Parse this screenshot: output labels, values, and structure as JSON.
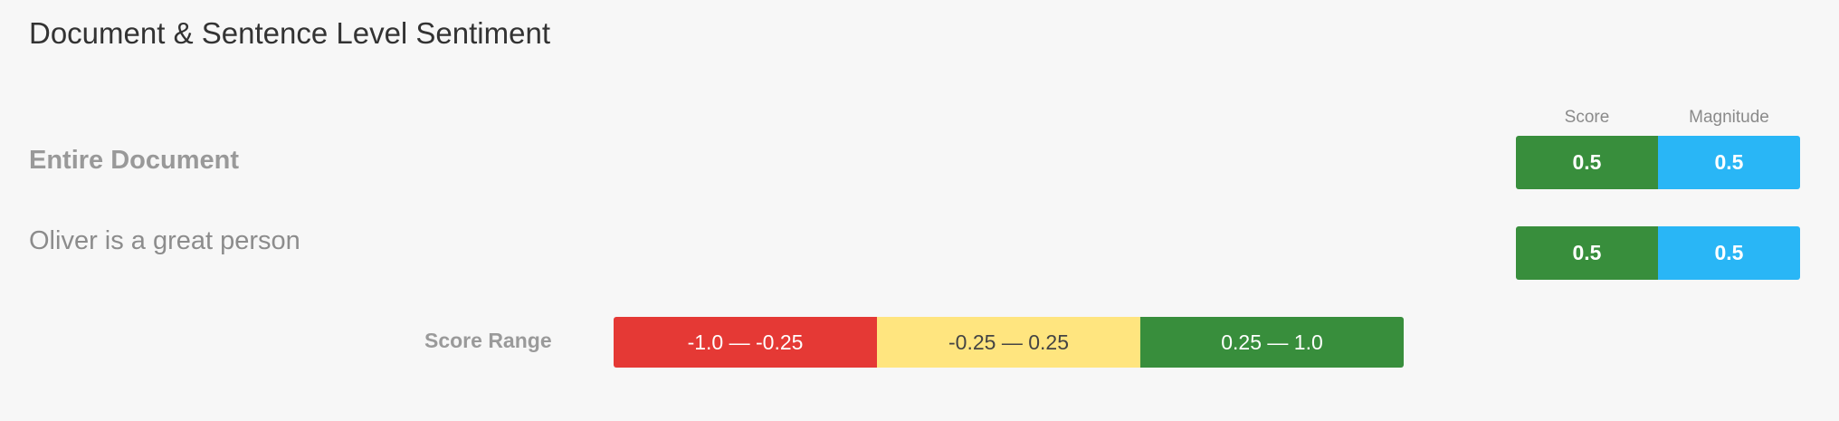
{
  "title": "Document & Sentence Level Sentiment",
  "columns": {
    "score": "Score",
    "magnitude": "Magnitude"
  },
  "rows": [
    {
      "label": "Entire Document",
      "score": "0.5",
      "magnitude": "0.5"
    },
    {
      "label": "Oliver is a great person",
      "score": "0.5",
      "magnitude": "0.5"
    }
  ],
  "score_range": {
    "label": "Score Range",
    "segments": [
      {
        "label": "-1.0 — -0.25",
        "color": "#e53935"
      },
      {
        "label": "-0.25 — 0.25",
        "color": "#ffe57f"
      },
      {
        "label": "0.25 — 1.0",
        "color": "#388e3c"
      }
    ]
  },
  "colors": {
    "score_cell": "#388e3c",
    "magnitude_cell": "#29b6f6",
    "background": "#f7f7f7"
  }
}
